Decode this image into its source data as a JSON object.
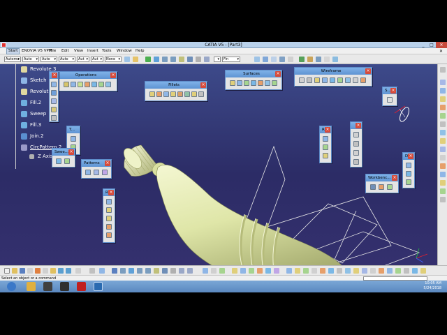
{
  "window": {
    "title": "CATIA V5 - [Part3]",
    "minimize": "_",
    "maximize": "□",
    "close": "✕"
  },
  "menu": [
    "Start",
    "ENOVIA V5 VPM",
    "File",
    "Edit",
    "View",
    "Insert",
    "Tools",
    "Window",
    "Help"
  ],
  "toolbar": {
    "combos": [
      "Automa",
      "Auto",
      "Auto",
      "Auto",
      "Aut",
      "Aut",
      "None",
      "",
      "Fin"
    ]
  },
  "tree": {
    "items": [
      "Revolute.3",
      "Sketch",
      "Revolut",
      "Fill.2",
      "Sweep",
      "Fill.3",
      "Join.2",
      "CircPattern.2",
      "Z Axis"
    ]
  },
  "palettes": {
    "operations": "Operations",
    "fillets": "Fillets",
    "surfaces": "Surfaces",
    "wireframe": "Wireframe",
    "patterns": "Patterns",
    "sweeps": "Swee...",
    "workbench": "Workbenc...",
    "small_t": "T...",
    "small_r": "R...",
    "small_r2": "R...",
    "small_s": "S...",
    "small_d": "D..."
  },
  "status": {
    "message": "Select an object or a command"
  },
  "clock": {
    "time": "10:05 AM",
    "date": "5/24/2018"
  },
  "colors": {
    "background_top": "#3d4a8a",
    "background_bottom": "#2c2c66",
    "part": "#dfe6a8",
    "palette_title": "#6aa0dc"
  },
  "icons": {
    "bottle": "bottle-model",
    "compass": "compass-icon",
    "axis": "axis-triad-icon"
  }
}
